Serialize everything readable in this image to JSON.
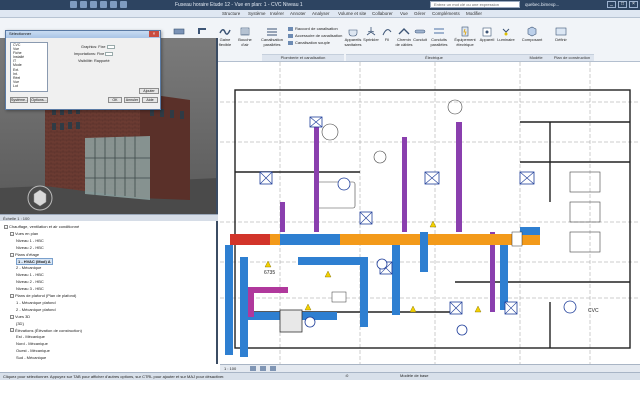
{
  "app": {
    "document_title": "Fuseau horaire Etude 12 - Vue en plan: 1 - CVC Niveau 1",
    "search_placeholder": "Entrez un mot clé ou une expression",
    "user": "quebec.bimexp...",
    "window_buttons": [
      "_",
      "□",
      "×"
    ]
  },
  "ribbon": {
    "tabs": [
      "Éléments",
      "Architecture",
      "Structure",
      "Système",
      "Insérer",
      "Annoter",
      "Analyser",
      "Volume et site",
      "Collaborer",
      "Vue",
      "Gérer",
      "Compléments",
      "Modifier"
    ],
    "buttons": [
      {
        "label": "Gaine",
        "icon": "duct-icon"
      },
      {
        "label": "Raccord de gaine",
        "icon": "duct-fitting-icon"
      },
      {
        "label": "Gaine flexible",
        "icon": "flex-duct-icon"
      },
      {
        "label": "Bouche d'air",
        "icon": "air-terminal-icon"
      },
      {
        "label": "Canalisation parallèles",
        "icon": "parallel-pipes-icon"
      },
      {
        "label": "Canalisation souple",
        "icon": "flex-pipe-icon"
      },
      {
        "label": "Appareils sanitaires",
        "icon": "plumbing-fixture-icon"
      },
      {
        "label": "Sprinkler",
        "icon": "sprinkler-icon"
      },
      {
        "label": "Fil",
        "icon": "wire-icon"
      },
      {
        "label": "Chemin de câbles",
        "icon": "cable-tray-icon"
      },
      {
        "label": "Conduit",
        "icon": "conduit-icon"
      },
      {
        "label": "Conduits parallèles",
        "icon": "parallel-conduit-icon"
      },
      {
        "label": "Équipement électrique",
        "icon": "electrical-equipment-icon"
      },
      {
        "label": "Appareil",
        "icon": "device-icon"
      },
      {
        "label": "Luminaire",
        "icon": "lighting-fixture-icon"
      },
      {
        "label": "Composant",
        "icon": "component-icon"
      },
      {
        "label": "Définir",
        "icon": "set-workplane-icon"
      }
    ],
    "small_buttons": [
      "Raccord de canalisation",
      "Accessoire de canalisation",
      "Canalisation souple"
    ],
    "panels": [
      "Plomberie et canalisation",
      "Électrique",
      "Modèle",
      "Plan de construction"
    ]
  },
  "dialog": {
    "title": "Sélectionner",
    "list_items": [
      "CVC",
      "Vue",
      "Fiche",
      "Installé",
      "IT",
      "Mode",
      "Ext.",
      "Int.",
      "Réel",
      "Vue",
      "Lot"
    ],
    "fields": [
      "Graphics: Fixe",
      "Importations: Fixe",
      "Visibilité: Rapporté"
    ],
    "buttons": [
      "Système...",
      "Options...",
      "OK",
      "Annuler",
      "Aide"
    ],
    "extra_button": "Ajouter"
  },
  "view3d_bar": "Échelle 1 : 100",
  "browser": {
    "lines": [
      {
        "text": "Chauffage, ventilation et air conditionné",
        "level": 0,
        "expander": "-"
      },
      {
        "text": "Vues en plan",
        "level": 1,
        "expander": "-"
      },
      {
        "text": "Niveau 1 - HBC",
        "level": 2,
        "expander": ""
      },
      {
        "text": "Niveau 2 - HBC",
        "level": 2,
        "expander": ""
      },
      {
        "text": "Plans d'étage",
        "level": 1,
        "expander": "-"
      },
      {
        "text": "1 - HVAC (Mod) A",
        "level": 2,
        "expander": "",
        "selected": true
      },
      {
        "text": "2 - Mécanique",
        "level": 2,
        "expander": ""
      },
      {
        "text": "Niveau 1 - HBC",
        "level": 2,
        "expander": ""
      },
      {
        "text": "Niveau 2 - HBC",
        "level": 2,
        "expander": ""
      },
      {
        "text": "Niveau 3 - HBC",
        "level": 2,
        "expander": ""
      },
      {
        "text": "Plans de plafond (Plan de plafond)",
        "level": 1,
        "expander": "-"
      },
      {
        "text": "1 - Mécanique plafond",
        "level": 2,
        "expander": ""
      },
      {
        "text": "2 - Mécanique plafond",
        "level": 2,
        "expander": ""
      },
      {
        "text": "Vues 3D",
        "level": 1,
        "expander": "-"
      },
      {
        "text": "{3D}",
        "level": 2,
        "expander": ""
      },
      {
        "text": "Élévations (Élévation de construction)",
        "level": 1,
        "expander": "-"
      },
      {
        "text": "Est - Mécanique",
        "level": 2,
        "expander": ""
      },
      {
        "text": "Nord - Mécanique",
        "level": 2,
        "expander": ""
      },
      {
        "text": "Ouest - Mécanique",
        "level": 2,
        "expander": ""
      },
      {
        "text": "Sud - Mécanique",
        "level": 2,
        "expander": ""
      }
    ]
  },
  "plan": {
    "room_label": "6735",
    "labels": [
      "CVC"
    ]
  },
  "view_controls": {
    "scale": "1 : 100",
    "model": "Modèle de base"
  },
  "status": {
    "message": "Cliquez pour sélectionner. Appuyez sur TAB pour afficher d'autres options, sur CTRL pour ajouter et sur MAJ pour désactiver.",
    "zoom": ":0",
    "model_label": "Modèle de base"
  },
  "colors": {
    "title_bar": "#2d4461",
    "ribbon": "#f1f4f8",
    "duct_blue": "#2e7fd1",
    "duct_orange": "#f39a1a",
    "duct_red": "#d2342a",
    "duct_purple": "#8a3fae",
    "duct_magenta": "#b0389c"
  }
}
